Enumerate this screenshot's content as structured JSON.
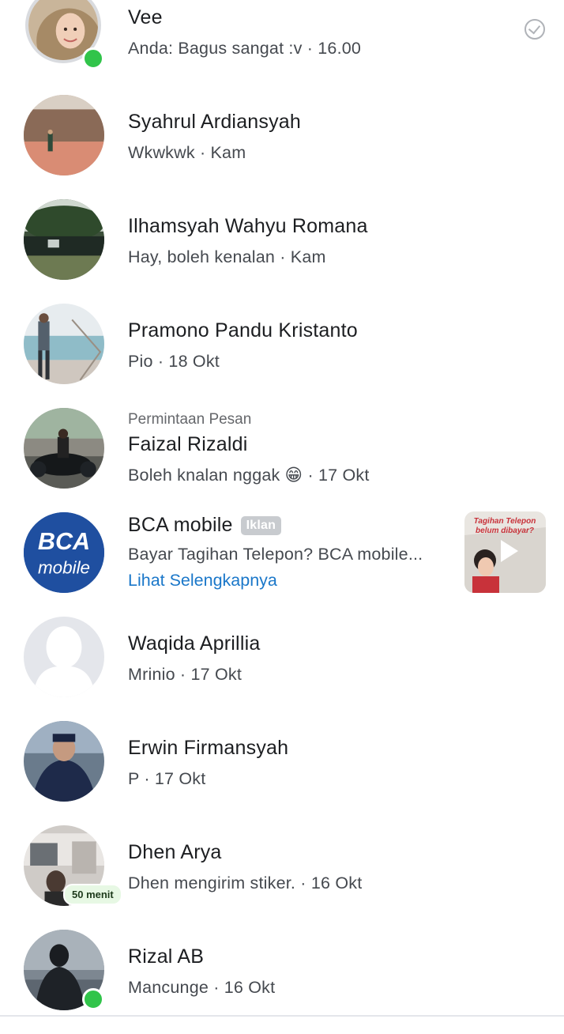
{
  "conversations": [
    {
      "name": "Vee",
      "preview": "Anda: Bagus sangat :v",
      "time": "16.00",
      "online": true,
      "status_icon": "seen-check-icon"
    },
    {
      "name": "Syahrul Ardiansyah",
      "preview": "Wkwkwk",
      "time": "Kam"
    },
    {
      "name": "Ilhamsyah Wahyu Romana",
      "preview": "Hay, boleh kenalan",
      "time": "Kam"
    },
    {
      "name": "Pramono Pandu Kristanto",
      "preview": "Pio",
      "time": "18 Okt"
    },
    {
      "label": "Permintaan Pesan",
      "name": "Faizal Rizaldi",
      "preview": "Boleh knalan nggak 😁",
      "time": "17 Okt"
    },
    {
      "name": "BCA mobile",
      "ad_badge": "Iklan",
      "preview": "Bayar Tagihan Telepon? BCA mobile...",
      "link": "Lihat Selengkapnya",
      "logo_text_1": "BCA",
      "logo_text_2": "mobile",
      "thumb_text": "Tagihan Telepon belum dibayar?"
    },
    {
      "name": "Waqida Aprillia",
      "preview": "Mrinio",
      "time": "17 Okt"
    },
    {
      "name": "Erwin Firmansyah",
      "preview": "P",
      "time": "17 Okt"
    },
    {
      "name": "Dhen Arya",
      "preview": "Dhen mengirim stiker.",
      "time": "16 Okt",
      "active_ago": "50 menit"
    },
    {
      "name": "Rizal AB",
      "preview": "Mancunge",
      "time": "16 Okt",
      "online": true
    }
  ],
  "separator": " · ",
  "colors": {
    "online": "#31c44a",
    "link": "#1a77c9",
    "bca_blue": "#1f4fa0"
  }
}
